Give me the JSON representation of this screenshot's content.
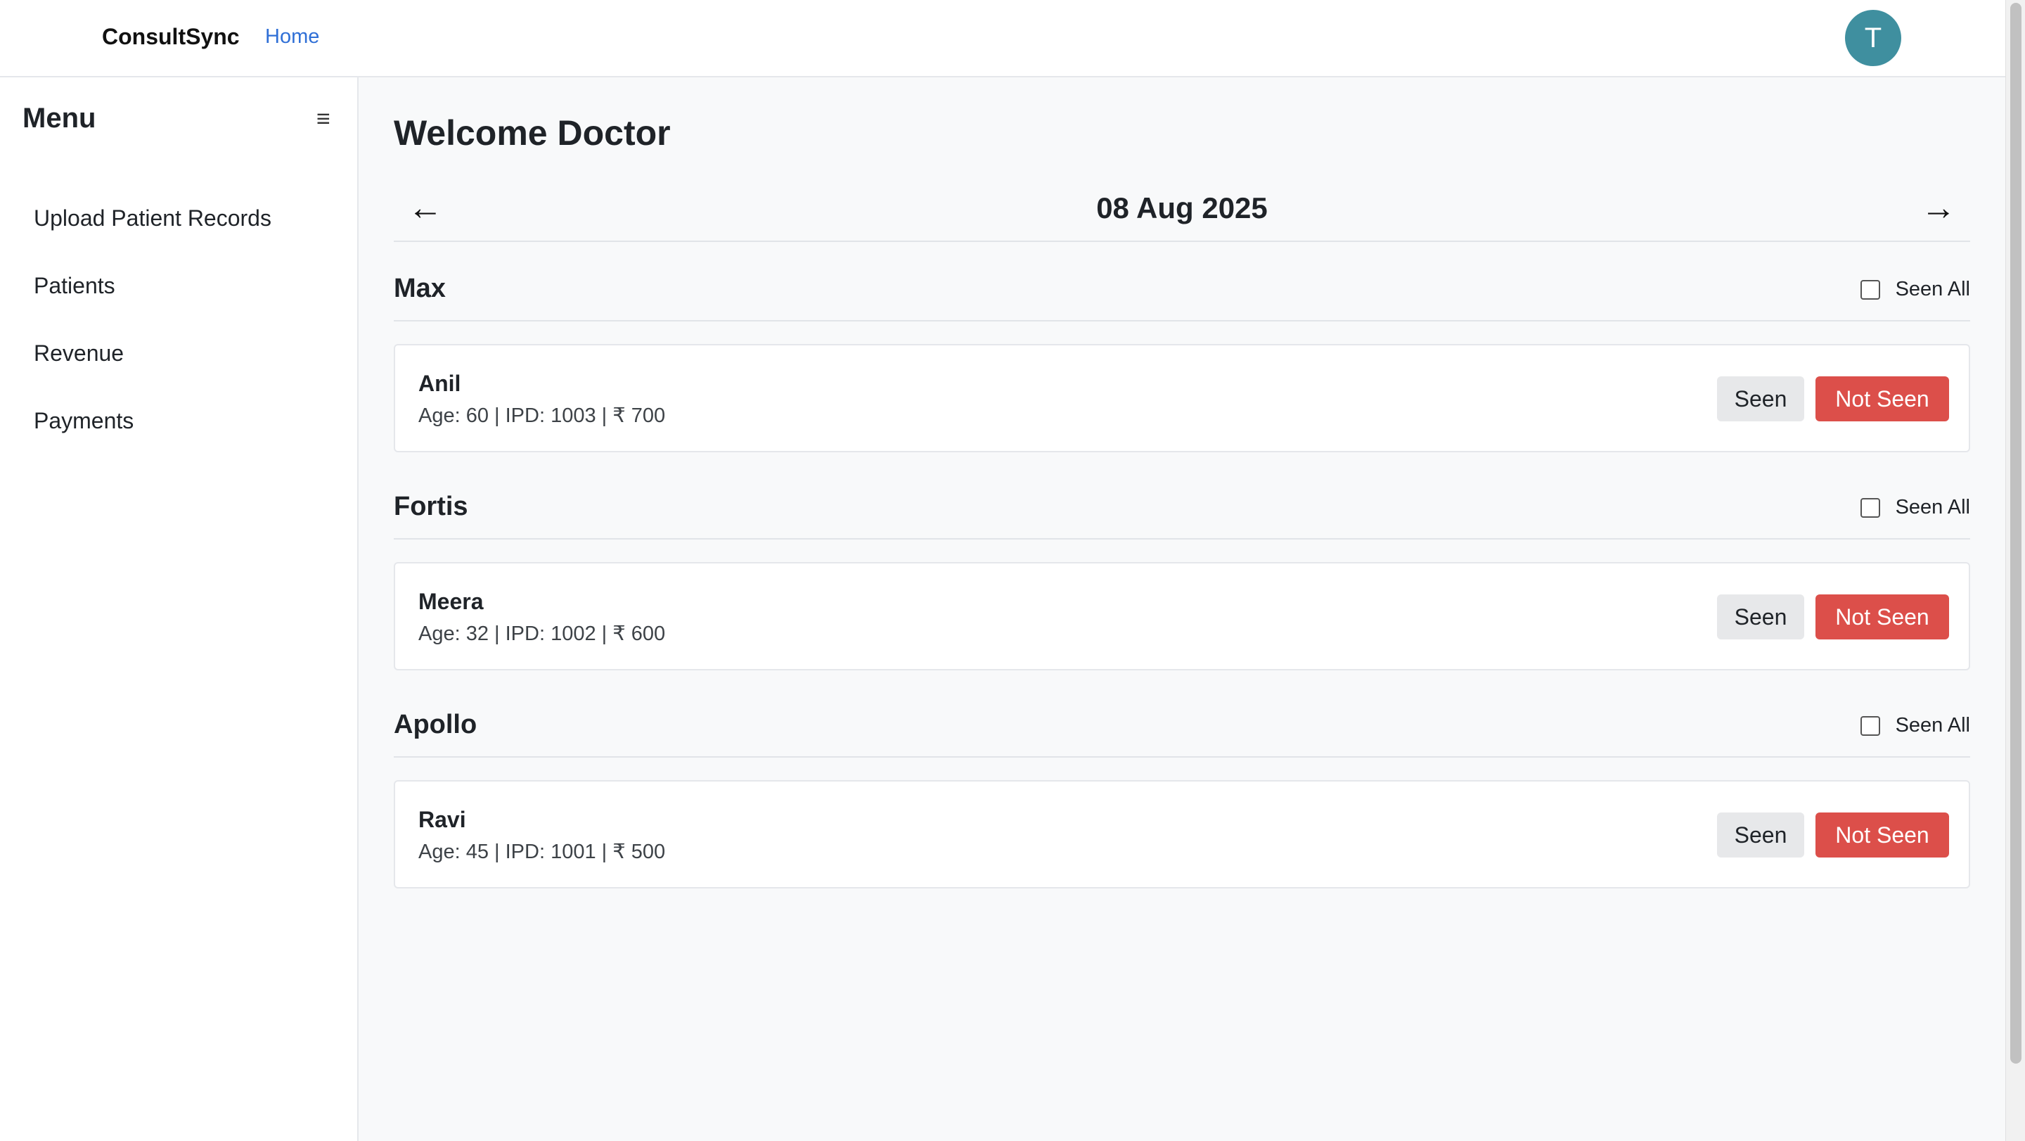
{
  "header": {
    "brand": "ConsultSync",
    "home_link": "Home",
    "avatar_initial": "T"
  },
  "sidebar": {
    "title": "Menu",
    "toggle_icon": "≡",
    "items": [
      {
        "label": "Upload Patient Records"
      },
      {
        "label": "Patients"
      },
      {
        "label": "Revenue"
      },
      {
        "label": "Payments"
      }
    ]
  },
  "main": {
    "welcome": "Welcome Doctor",
    "date": "08 Aug 2025",
    "prev_icon": "←",
    "next_icon": "→",
    "seen_all_label": "Seen All",
    "seen_label": "Seen",
    "not_seen_label": "Not Seen",
    "groups": [
      {
        "hospital": "Max",
        "patients": [
          {
            "name": "Anil",
            "details": "Age: 60 | IPD: 1003 | ₹ 700"
          }
        ]
      },
      {
        "hospital": "Fortis",
        "patients": [
          {
            "name": "Meera",
            "details": "Age: 32 | IPD: 1002 | ₹ 600"
          }
        ]
      },
      {
        "hospital": "Apollo",
        "patients": [
          {
            "name": "Ravi",
            "details": "Age: 45 | IPD: 1001 | ₹ 500"
          }
        ]
      }
    ]
  },
  "colors": {
    "accent_link": "#2f6fd6",
    "avatar": "#3f8f9f",
    "not_seen": "#dc4f4a",
    "seen_btn": "#e7e8ea"
  }
}
